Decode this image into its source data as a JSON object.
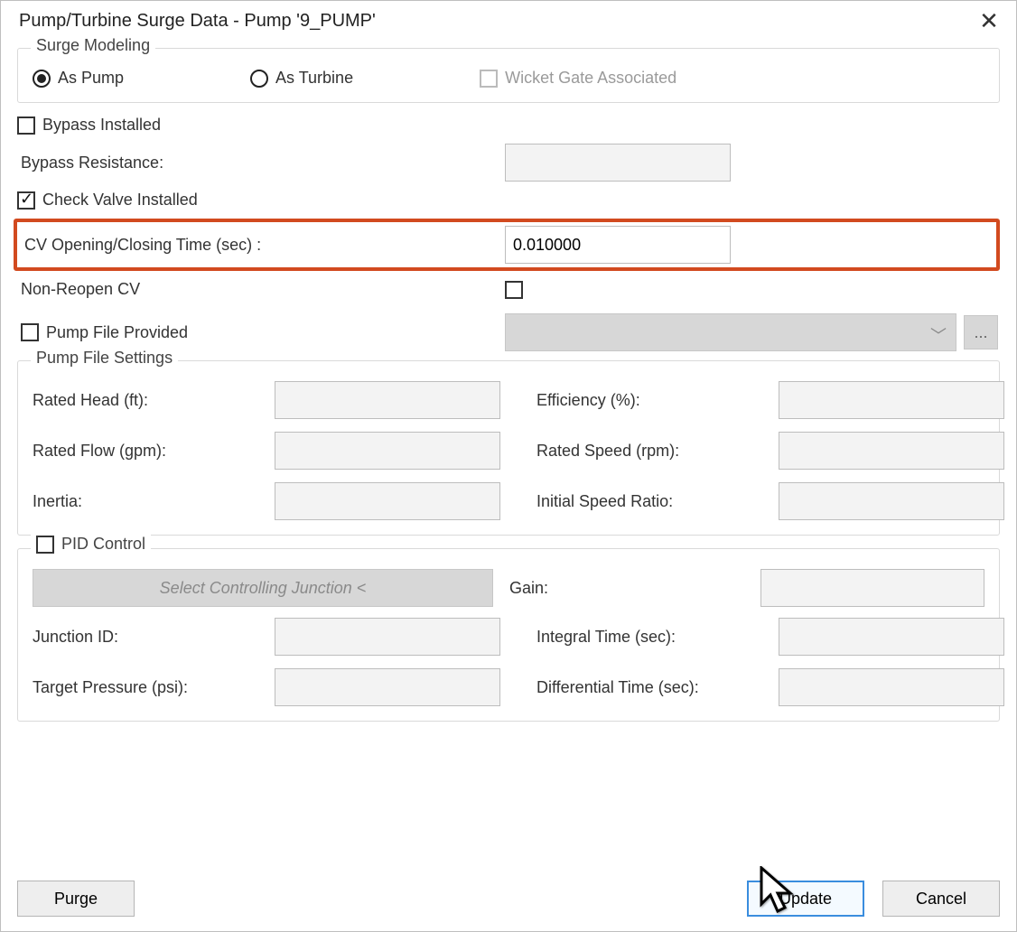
{
  "window": {
    "title": "Pump/Turbine Surge Data - Pump '9_PUMP'"
  },
  "surge_modeling": {
    "group_title": "Surge Modeling",
    "as_pump": "As Pump",
    "as_turbine": "As Turbine",
    "wicket_gate": "Wicket Gate Associated",
    "selected": "as_pump"
  },
  "bypass": {
    "installed_label": "Bypass Installed",
    "installed": false,
    "resistance_label": "Bypass Resistance:",
    "resistance_value": ""
  },
  "check_valve": {
    "installed_label": "Check Valve Installed",
    "installed": true,
    "cv_time_label": "CV Opening/Closing Time (sec) :",
    "cv_time_value": "0.010000",
    "non_reopen_label": "Non-Reopen CV",
    "non_reopen": false
  },
  "pump_file": {
    "provided_label": "Pump File Provided",
    "provided": false,
    "path": "",
    "ellipsis": "..."
  },
  "pump_file_settings": {
    "group_title": "Pump File Settings",
    "rated_head_label": "Rated Head (ft):",
    "rated_head": "",
    "efficiency_label": "Efficiency (%):",
    "efficiency": "",
    "rated_flow_label": "Rated Flow (gpm):",
    "rated_flow": "",
    "rated_speed_label": "Rated Speed (rpm):",
    "rated_speed": "",
    "inertia_label": "Inertia:",
    "inertia": "",
    "initial_speed_ratio_label": "Initial Speed Ratio:",
    "initial_speed_ratio": ""
  },
  "pid": {
    "group_label": "PID Control",
    "enabled": false,
    "select_junction": "Select Controlling Junction <",
    "junction_id_label": "Junction ID:",
    "junction_id": "",
    "target_pressure_label": "Target Pressure (psi):",
    "target_pressure": "",
    "gain_label": "Gain:",
    "gain": "",
    "integral_label": "Integral Time (sec):",
    "integral": "",
    "differential_label": "Differential Time (sec):",
    "differential": ""
  },
  "buttons": {
    "purge": "Purge",
    "update": "Update",
    "cancel": "Cancel"
  }
}
